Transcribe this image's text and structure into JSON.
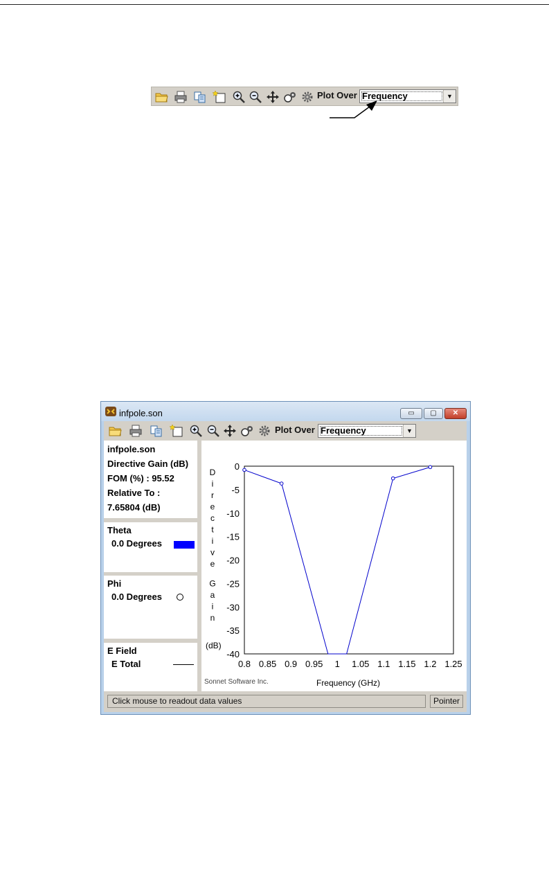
{
  "toolbar": {
    "icons": [
      "open-folder-icon",
      "print-icon",
      "copy-icon",
      "new-graph-icon",
      "zoom-in-icon",
      "zoom-out-icon",
      "pan-icon",
      "settings-icon",
      "gear-icon"
    ],
    "plot_over_label": "Plot Over",
    "plot_over_value": "Frequency"
  },
  "window": {
    "title": "infpole.son",
    "buttons": {
      "minimize": "▭",
      "maximize": "▢",
      "close": "✕"
    },
    "info_panel": {
      "file": "infpole.son",
      "quantity": "Directive Gain (dB)",
      "fom": "FOM (%) : 95.52",
      "relative_label": "Relative To :",
      "relative_value": "7.65804 (dB)"
    },
    "theta_panel": {
      "title": "Theta",
      "item": "0.0 Degrees",
      "swatch_color": "#0000ff"
    },
    "phi_panel": {
      "title": "Phi",
      "item": "0.0 Degrees",
      "marker": "circle"
    },
    "efield_panel": {
      "title": "E Field",
      "item": "E Total",
      "line": "solid"
    },
    "status": {
      "message": "Click mouse to readout data values",
      "mode_button": "Pointer"
    }
  },
  "chart_data": {
    "type": "line",
    "title": "",
    "xlabel": "Frequency (GHz)",
    "ylabel": "Directive Gain",
    "yunit": "(dB)",
    "watermark": "Sonnet Software Inc.",
    "xlim": [
      0.8,
      1.25
    ],
    "ylim": [
      -40,
      0
    ],
    "xticks": [
      "0.8",
      "0.85",
      "0.9",
      "0.95",
      "1",
      "1.05",
      "1.1",
      "1.15",
      "1.2",
      "1.25"
    ],
    "yticks": [
      "0",
      "-5",
      "-10",
      "-15",
      "-20",
      "-25",
      "-30",
      "-35",
      "-40"
    ],
    "series": [
      {
        "color": "#0000cc",
        "x": [
          0.8,
          0.88,
          0.98,
          1.02,
          1.12,
          1.2
        ],
        "y": [
          -0.8,
          -3.7,
          -40,
          -40,
          -2.6,
          -0.2
        ],
        "markers": [
          true,
          true,
          false,
          false,
          true,
          true
        ]
      }
    ]
  }
}
